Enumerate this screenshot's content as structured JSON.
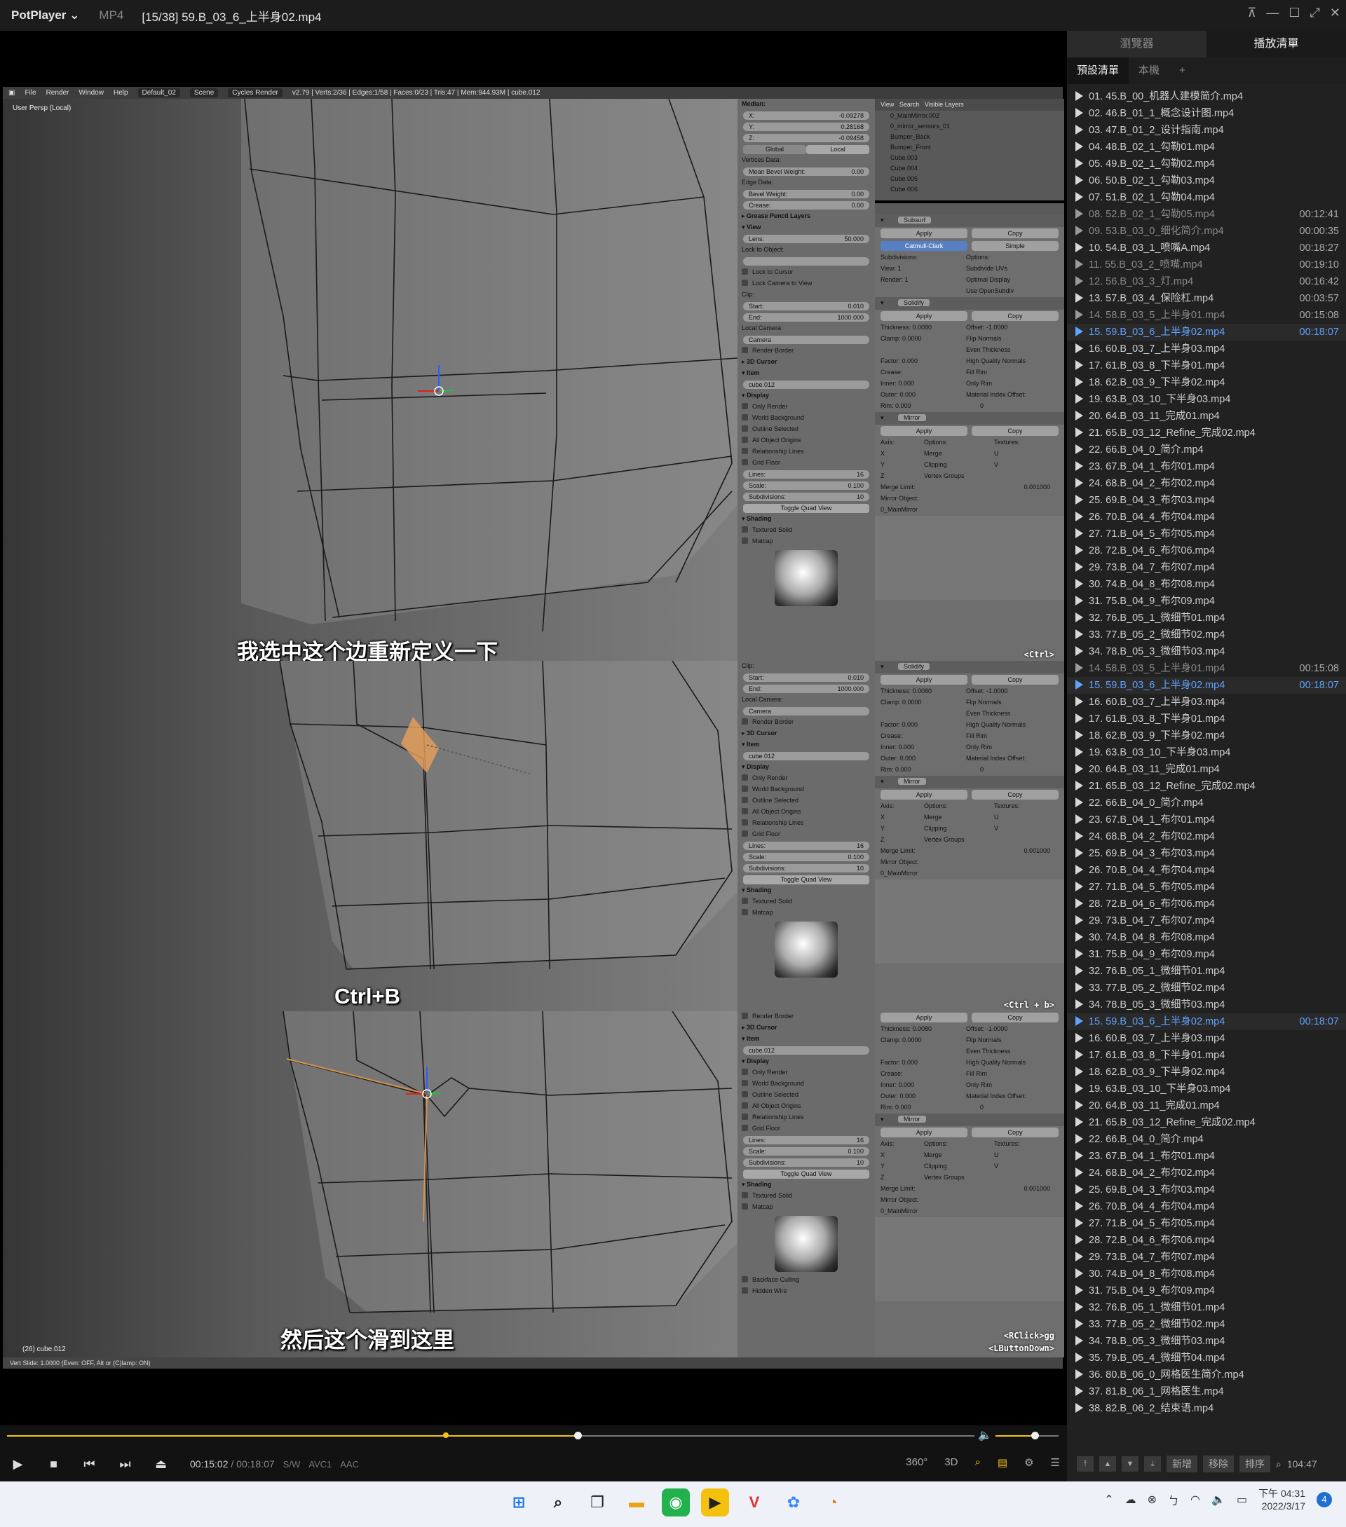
{
  "titlebar": {
    "app": "PotPlayer ⌄",
    "format": "MP4",
    "title": "[15/38] 59.B_03_6_上半身02.mp4"
  },
  "blender": {
    "header": {
      "menus": [
        "File",
        "Render",
        "Window",
        "Help"
      ],
      "layout": "Default_02",
      "scene": "Scene",
      "engine": "Cycles Render",
      "stats": "v2.79 | Verts:2/36 | Edges:1/58 | Faces:0/23 | Tris:47 | Mem:944.93M | cube.012"
    },
    "viewport_label": "User Persp (Local)",
    "object_label": "(26) cube.012",
    "status": "Vert Slide: 1.0000 (Even: OFF, Alt or (C)lamp: ON)",
    "outliner": {
      "header": [
        "View",
        "Search",
        "Visible Layers"
      ],
      "items": [
        "0_MainMirror.002",
        "0_mirror_sensors_01",
        "Bumper_Back",
        "Bumper_Front",
        "Cube.003",
        "Cube.004",
        "Cube.005",
        "Cube.006"
      ]
    },
    "npanel": {
      "median": "Median:",
      "x_label": "X:",
      "x": "-0.09278",
      "y_label": "Y:",
      "y": "0.28168",
      "z_label": "Z:",
      "z": "-0.09458",
      "global": "Global",
      "local": "Local",
      "vertices_data": "Vertices Data:",
      "mean_bevel": "Mean Bevel Weight:",
      "mean_bevel_val": "0.00",
      "edge_data": "Edge Data:",
      "bevel_weight": "Bevel Weight:",
      "bevel_val": "0.00",
      "crease": "Crease:",
      "crease_val": "0.00",
      "grease": "Grease Pencil Layers",
      "view": "View",
      "lens": "Lens:",
      "lens_val": "50.000",
      "lock_obj": "Lock to Object:",
      "lock_cursor": "Lock to Cursor",
      "lock_cam": "Lock Camera to View",
      "clip": "Clip:",
      "start": "Start:",
      "start_val": "0.010",
      "end": "End:",
      "end_val": "1000.000",
      "local_camera": "Local Camera:",
      "camera": "Camera",
      "render_border": "Render Border",
      "cursor3d": "3D Cursor",
      "item": "Item",
      "item_name": "cube.012",
      "display": "Display",
      "only_render": "Only Render",
      "world_bg": "World Background",
      "outline_sel": "Outline Selected",
      "all_origins": "All Object Origins",
      "rel_lines": "Relationship Lines",
      "grid_floor": "Grid Floor",
      "lines": "Lines:",
      "lines_val": "16",
      "scale": "Scale:",
      "scale_val": "0.100",
      "subdiv": "Subdivisions:",
      "subdiv_val": "10",
      "toggle_quad": "Toggle Quad View",
      "shading": "Shading",
      "textured": "Textured Solid",
      "matcap": "Matcap",
      "backface": "Backface Culling",
      "hidden_wire": "Hidden Wire"
    },
    "modifiers": {
      "subsurf": "Subsurf",
      "apply": "Apply",
      "copy": "Copy",
      "catmull": "Catmull-Clark",
      "simple": "Simple",
      "subdivisions": "Subdivisions:",
      "options": "Options:",
      "view": "View:",
      "view_val": "1",
      "render": "Render:",
      "render_val": "1",
      "subdiv_uvs": "Subdivide UVs",
      "optimal": "Optimal Display",
      "opensubdiv": "Use OpenSubdiv",
      "solidify": "Solidify",
      "thickness": "Thickness:",
      "thickness_val": "0.0080",
      "offset": "Offset:",
      "offset_val": "-1.0000",
      "clamp": "Clamp:",
      "clamp_val": "0.0000",
      "flip": "Flip Normals",
      "even": "Even Thickness",
      "hq": "High Quality Normals",
      "fill": "Fill Rim",
      "only_rim": "Only Rim",
      "factor": "Factor:",
      "factor_val": "0.000",
      "crease": "Crease:",
      "inner": "Inner:",
      "inner_val": "0.000",
      "outer": "Outer:",
      "outer_val": "0.000",
      "rim": "Rim:",
      "rim_val": "0.000",
      "mat_index": "Material Index Offset:",
      "mat_val": "0",
      "mirror": "Mirror",
      "axis": "Axis:",
      "textures": "Textures:",
      "x": "X",
      "y": "Y",
      "z": "Z",
      "merge": "Merge",
      "clipping": "Clipping",
      "vgroups": "Vertex Groups",
      "u": "U",
      "v": "V",
      "merge_limit": "Merge Limit:",
      "merge_val": "0.001000",
      "mirror_obj": "Mirror Object:",
      "mirror_obj_val": "0_MainMirror"
    },
    "keys": [
      "<Ctrl>",
      "<Ctrl + b>",
      "<RClick>gg",
      "<LButtonDown>"
    ]
  },
  "subtitles": [
    "我选中这个边重新定义一下",
    "Ctrl+B",
    "然后这个滑到这里"
  ],
  "player": {
    "current": "00:15:02",
    "total": "00:18:07",
    "sw": "S/W",
    "vcodec": "AVC1",
    "acodec": "AAC",
    "progress": 0.59,
    "volume": 0.62,
    "right_controls": [
      "360°",
      "3D"
    ]
  },
  "playlist": {
    "tabs": [
      "瀏覽器",
      "播放清單"
    ],
    "subtabs": [
      "預設清單",
      "本機",
      "+"
    ],
    "items": [
      {
        "t": "01. 45.B_00_机器人建模简介.mp4",
        "d": "",
        "s": ""
      },
      {
        "t": "02. 46.B_01_1_概念设计图.mp4",
        "d": "",
        "s": ""
      },
      {
        "t": "03. 47.B_01_2_设计指南.mp4",
        "d": "",
        "s": ""
      },
      {
        "t": "04. 48.B_02_1_勾勒01.mp4",
        "d": "",
        "s": ""
      },
      {
        "t": "05. 49.B_02_1_勾勒02.mp4",
        "d": "",
        "s": ""
      },
      {
        "t": "06. 50.B_02_1_勾勒03.mp4",
        "d": "",
        "s": ""
      },
      {
        "t": "07. 51.B_02_1_勾勒04.mp4",
        "d": "",
        "s": ""
      },
      {
        "t": "08. 52.B_02_1_勾勒05.mp4",
        "d": "00:12:41",
        "s": "dim"
      },
      {
        "t": "09. 53.B_03_0_细化简介.mp4",
        "d": "00:00:35",
        "s": "dim"
      },
      {
        "t": "10. 54.B_03_1_喷嘴A.mp4",
        "d": "00:18:27",
        "s": ""
      },
      {
        "t": "11. 55.B_03_2_喷嘴.mp4",
        "d": "00:19:10",
        "s": "dim"
      },
      {
        "t": "12. 56.B_03_3_灯.mp4",
        "d": "00:16:42",
        "s": "dim"
      },
      {
        "t": "13. 57.B_03_4_保险杠.mp4",
        "d": "00:03:57",
        "s": ""
      },
      {
        "t": "14. 58.B_03_5_上半身01.mp4",
        "d": "00:15:08",
        "s": "dim"
      },
      {
        "t": "15. 59.B_03_6_上半身02.mp4",
        "d": "00:18:07",
        "s": "cur"
      },
      {
        "t": "16. 60.B_03_7_上半身03.mp4",
        "d": "",
        "s": ""
      },
      {
        "t": "17. 61.B_03_8_下半身01.mp4",
        "d": "",
        "s": ""
      },
      {
        "t": "18. 62.B_03_9_下半身02.mp4",
        "d": "",
        "s": ""
      },
      {
        "t": "19. 63.B_03_10_下半身03.mp4",
        "d": "",
        "s": ""
      },
      {
        "t": "20. 64.B_03_11_完成01.mp4",
        "d": "",
        "s": ""
      },
      {
        "t": "21. 65.B_03_12_Refine_完成02.mp4",
        "d": "",
        "s": ""
      },
      {
        "t": "22. 66.B_04_0_简介.mp4",
        "d": "",
        "s": ""
      },
      {
        "t": "23. 67.B_04_1_布尔01.mp4",
        "d": "",
        "s": ""
      },
      {
        "t": "24. 68.B_04_2_布尔02.mp4",
        "d": "",
        "s": ""
      },
      {
        "t": "25. 69.B_04_3_布尔03.mp4",
        "d": "",
        "s": ""
      },
      {
        "t": "26. 70.B_04_4_布尔04.mp4",
        "d": "",
        "s": ""
      },
      {
        "t": "27. 71.B_04_5_布尔05.mp4",
        "d": "",
        "s": ""
      },
      {
        "t": "28. 72.B_04_6_布尔06.mp4",
        "d": "",
        "s": ""
      },
      {
        "t": "29. 73.B_04_7_布尔07.mp4",
        "d": "",
        "s": ""
      },
      {
        "t": "30. 74.B_04_8_布尔08.mp4",
        "d": "",
        "s": ""
      },
      {
        "t": "31. 75.B_04_9_布尔09.mp4",
        "d": "",
        "s": ""
      },
      {
        "t": "32. 76.B_05_1_微细节01.mp4",
        "d": "",
        "s": ""
      },
      {
        "t": "33. 77.B_05_2_微细节02.mp4",
        "d": "",
        "s": ""
      },
      {
        "t": "34. 78.B_05_3_微细节03.mp4",
        "d": "",
        "s": ""
      },
      {
        "t": "14. 58.B_03_5_上半身01.mp4",
        "d": "00:15:08",
        "s": "dim"
      },
      {
        "t": "15. 59.B_03_6_上半身02.mp4",
        "d": "00:18:07",
        "s": "cur"
      },
      {
        "t": "16. 60.B_03_7_上半身03.mp4",
        "d": "",
        "s": ""
      },
      {
        "t": "17. 61.B_03_8_下半身01.mp4",
        "d": "",
        "s": ""
      },
      {
        "t": "18. 62.B_03_9_下半身02.mp4",
        "d": "",
        "s": ""
      },
      {
        "t": "19. 63.B_03_10_下半身03.mp4",
        "d": "",
        "s": ""
      },
      {
        "t": "20. 64.B_03_11_完成01.mp4",
        "d": "",
        "s": ""
      },
      {
        "t": "21. 65.B_03_12_Refine_完成02.mp4",
        "d": "",
        "s": ""
      },
      {
        "t": "22. 66.B_04_0_简介.mp4",
        "d": "",
        "s": ""
      },
      {
        "t": "23. 67.B_04_1_布尔01.mp4",
        "d": "",
        "s": ""
      },
      {
        "t": "24. 68.B_04_2_布尔02.mp4",
        "d": "",
        "s": ""
      },
      {
        "t": "25. 69.B_04_3_布尔03.mp4",
        "d": "",
        "s": ""
      },
      {
        "t": "26. 70.B_04_4_布尔04.mp4",
        "d": "",
        "s": ""
      },
      {
        "t": "27. 71.B_04_5_布尔05.mp4",
        "d": "",
        "s": ""
      },
      {
        "t": "28. 72.B_04_6_布尔06.mp4",
        "d": "",
        "s": ""
      },
      {
        "t": "29. 73.B_04_7_布尔07.mp4",
        "d": "",
        "s": ""
      },
      {
        "t": "30. 74.B_04_8_布尔08.mp4",
        "d": "",
        "s": ""
      },
      {
        "t": "31. 75.B_04_9_布尔09.mp4",
        "d": "",
        "s": ""
      },
      {
        "t": "32. 76.B_05_1_微细节01.mp4",
        "d": "",
        "s": ""
      },
      {
        "t": "33. 77.B_05_2_微细节02.mp4",
        "d": "",
        "s": ""
      },
      {
        "t": "34. 78.B_05_3_微细节03.mp4",
        "d": "",
        "s": ""
      },
      {
        "t": "15. 59.B_03_6_上半身02.mp4",
        "d": "00:18:07",
        "s": "cur"
      },
      {
        "t": "16. 60.B_03_7_上半身03.mp4",
        "d": "",
        "s": ""
      },
      {
        "t": "17. 61.B_03_8_下半身01.mp4",
        "d": "",
        "s": ""
      },
      {
        "t": "18. 62.B_03_9_下半身02.mp4",
        "d": "",
        "s": ""
      },
      {
        "t": "19. 63.B_03_10_下半身03.mp4",
        "d": "",
        "s": ""
      },
      {
        "t": "20. 64.B_03_11_完成01.mp4",
        "d": "",
        "s": ""
      },
      {
        "t": "21. 65.B_03_12_Refine_完成02.mp4",
        "d": "",
        "s": ""
      },
      {
        "t": "22. 66.B_04_0_简介.mp4",
        "d": "",
        "s": ""
      },
      {
        "t": "23. 67.B_04_1_布尔01.mp4",
        "d": "",
        "s": ""
      },
      {
        "t": "24. 68.B_04_2_布尔02.mp4",
        "d": "",
        "s": ""
      },
      {
        "t": "25. 69.B_04_3_布尔03.mp4",
        "d": "",
        "s": ""
      },
      {
        "t": "26. 70.B_04_4_布尔04.mp4",
        "d": "",
        "s": ""
      },
      {
        "t": "27. 71.B_04_5_布尔05.mp4",
        "d": "",
        "s": ""
      },
      {
        "t": "28. 72.B_04_6_布尔06.mp4",
        "d": "",
        "s": ""
      },
      {
        "t": "29. 73.B_04_7_布尔07.mp4",
        "d": "",
        "s": ""
      },
      {
        "t": "30. 74.B_04_8_布尔08.mp4",
        "d": "",
        "s": ""
      },
      {
        "t": "31. 75.B_04_9_布尔09.mp4",
        "d": "",
        "s": ""
      },
      {
        "t": "32. 76.B_05_1_微细节01.mp4",
        "d": "",
        "s": ""
      },
      {
        "t": "33. 77.B_05_2_微细节02.mp4",
        "d": "",
        "s": ""
      },
      {
        "t": "34. 78.B_05_3_微细节03.mp4",
        "d": "",
        "s": ""
      },
      {
        "t": "35. 79.B_05_4_微细节04.mp4",
        "d": "",
        "s": ""
      },
      {
        "t": "36. 80.B_06_0_网格医生简介.mp4",
        "d": "",
        "s": ""
      },
      {
        "t": "37. 81.B_06_1_网格医生.mp4",
        "d": "",
        "s": ""
      },
      {
        "t": "38. 82.B_06_2_结束语.mp4",
        "d": "",
        "s": ""
      }
    ],
    "bottom": {
      "add": "新增",
      "remove": "移除",
      "sort": "排序",
      "total": "104:47"
    }
  },
  "taskbar": {
    "time": "下午 04:31",
    "date": "2022/3/17",
    "notifications": "4"
  }
}
